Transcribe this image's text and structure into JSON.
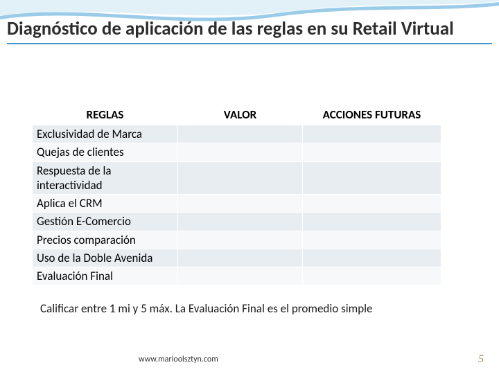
{
  "title": "Diagnóstico de aplicación de las reglas en su Retail Virtual",
  "table": {
    "headers": {
      "c0": "REGLAS",
      "c1": "VALOR",
      "c2": "ACCIONES FUTURAS"
    },
    "rows": [
      {
        "c0": "Exclusividad de Marca",
        "c1": "",
        "c2": ""
      },
      {
        "c0": "Quejas de clientes",
        "c1": "",
        "c2": ""
      },
      {
        "c0": "Respuesta de la interactividad",
        "c1": "",
        "c2": ""
      },
      {
        "c0": "Aplica el CRM",
        "c1": "",
        "c2": ""
      },
      {
        "c0": "Gestión E-Comercio",
        "c1": "",
        "c2": ""
      },
      {
        "c0": "Precios comparación",
        "c1": "",
        "c2": ""
      },
      {
        "c0": "Uso de la Doble Avenida",
        "c1": "",
        "c2": ""
      },
      {
        "c0": "Evaluación Final",
        "c1": "",
        "c2": ""
      }
    ]
  },
  "note": "Calificar entre 1 mi y 5 máx. La Evaluación Final es el promedio simple",
  "footer_url": "www.marioolsztyn.com",
  "page_number": "5"
}
